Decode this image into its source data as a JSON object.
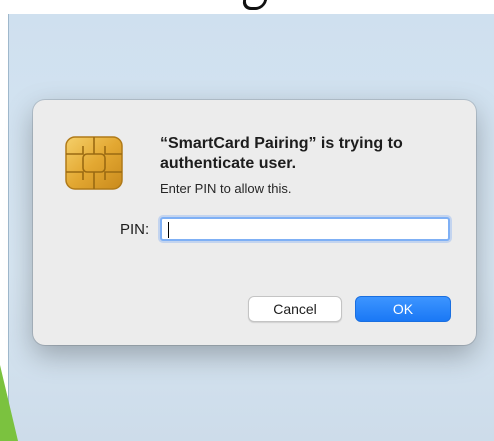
{
  "dialog": {
    "title": "“SmartCard Pairing” is trying to authenticate user.",
    "subtitle": "Enter PIN to allow this.",
    "pin_label": "PIN:",
    "pin_value": "",
    "cancel_label": "Cancel",
    "ok_label": "OK",
    "icon": "smartcard-chip-icon"
  },
  "colors": {
    "accent": "#1a78f5",
    "dialog_background": "#ececec",
    "wallpaper": "#cfe0ef"
  }
}
